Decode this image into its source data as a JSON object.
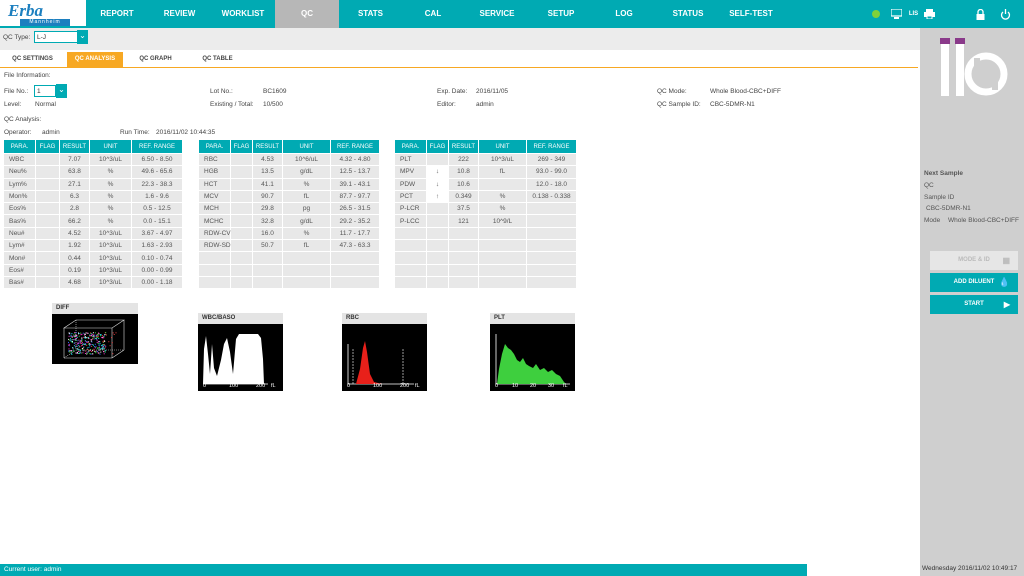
{
  "app": {
    "logo": "Erba",
    "logo_sub": "Mannheim"
  },
  "nav": [
    {
      "label": "REPORT"
    },
    {
      "label": "REVIEW"
    },
    {
      "label": "WORKLIST"
    },
    {
      "label": "QC"
    },
    {
      "label": "STATS"
    },
    {
      "label": "CAL"
    },
    {
      "label": "SERVICE"
    },
    {
      "label": "SETUP"
    },
    {
      "label": "LOG"
    },
    {
      "label": "STATUS"
    },
    {
      "label": "SELF-TEST"
    }
  ],
  "nav_active": "QC",
  "top_icons": [
    "status-dot-icon",
    "network-icon",
    "language-icon",
    "printer-icon",
    "lock-icon",
    "power-icon"
  ],
  "status_dot_color": "#7fd13b",
  "qc_type": {
    "label": "QC Type:",
    "value": "L-J"
  },
  "tabs": [
    {
      "label": "QC SETTINGS"
    },
    {
      "label": "QC ANALYSIS"
    },
    {
      "label": "QC GRAPH"
    },
    {
      "label": "QC TABLE"
    }
  ],
  "tab_active": "QC ANALYSIS",
  "file_info": {
    "heading": "File Information:",
    "file_no_label": "File No.:",
    "file_no_value": "1",
    "level_label": "Level:",
    "level_value": "Normal",
    "lot_label": "Lot No.:",
    "lot_value": "BC1609",
    "existing_label": "Existing / Total:",
    "existing_value": "10/500",
    "exp_label": "Exp. Date:",
    "exp_value": "2016/11/05",
    "editor_label": "Editor:",
    "editor_value": "admin",
    "mode_label": "QC Mode:",
    "mode_value": "Whole Blood-CBC+DIFF",
    "sample_label": "QC Sample ID:",
    "sample_value": "CBC-5DMR-N1"
  },
  "analysis": {
    "heading": "QC Analysis:",
    "operator_label": "Operator:",
    "operator_value": "admin",
    "runtime_label": "Run Time:",
    "runtime_value": "2016/11/02 10:44:35"
  },
  "table_headers": [
    "PARA.",
    "FLAG",
    "RESULT",
    "UNIT",
    "REF. RANGE"
  ],
  "wbc_table": [
    [
      "WBC",
      "",
      "7.07",
      "10^3/uL",
      "6.50 - 8.50"
    ],
    [
      "Neu%",
      "",
      "63.8",
      "%",
      "49.6 - 65.6"
    ],
    [
      "Lym%",
      "",
      "27.1",
      "%",
      "22.3 - 38.3"
    ],
    [
      "Mon%",
      "",
      "6.3",
      "%",
      "1.6 - 9.6"
    ],
    [
      "Eos%",
      "",
      "2.8",
      "%",
      "0.5 - 12.5"
    ],
    [
      "Bas%",
      "",
      "66.2",
      "%",
      "0.0 - 15.1"
    ],
    [
      "Neu#",
      "",
      "4.52",
      "10^3/uL",
      "3.67 - 4.97"
    ],
    [
      "Lym#",
      "",
      "1.92",
      "10^3/uL",
      "1.63 - 2.93"
    ],
    [
      "Mon#",
      "",
      "0.44",
      "10^3/uL",
      "0.10 - 0.74"
    ],
    [
      "Eos#",
      "",
      "0.19",
      "10^3/uL",
      "0.00 - 0.99"
    ],
    [
      "Bas#",
      "",
      "4.68",
      "10^3/uL",
      "0.00 - 1.18"
    ]
  ],
  "rbc_table": [
    [
      "RBC",
      "",
      "4.53",
      "10^6/uL",
      "4.32 - 4.80"
    ],
    [
      "HGB",
      "",
      "13.5",
      "g/dL",
      "12.5 - 13.7"
    ],
    [
      "HCT",
      "",
      "41.1",
      "%",
      "39.1 - 43.1"
    ],
    [
      "MCV",
      "",
      "90.7",
      "fL",
      "87.7 - 97.7"
    ],
    [
      "MCH",
      "",
      "29.8",
      "pg",
      "26.5 - 31.5"
    ],
    [
      "MCHC",
      "",
      "32.8",
      "g/dL",
      "29.2 - 35.2"
    ],
    [
      "RDW-CV",
      "",
      "16.0",
      "%",
      "11.7 - 17.7"
    ],
    [
      "RDW-SD",
      "",
      "50.7",
      "fL",
      "47.3 - 63.3"
    ],
    [
      "",
      "",
      "",
      "",
      ""
    ],
    [
      "",
      "",
      "",
      "",
      ""
    ],
    [
      "",
      "",
      "",
      "",
      ""
    ]
  ],
  "plt_table": [
    [
      "PLT",
      "",
      "222",
      "10^3/uL",
      "269 - 349"
    ],
    [
      "MPV",
      "↓",
      "10.8",
      "fL",
      "93.0 - 99.0"
    ],
    [
      "PDW",
      "↓",
      "10.6",
      "",
      "12.0 - 18.0"
    ],
    [
      "PCT",
      "↑",
      "0.349",
      "%",
      "0.138 - 0.338"
    ],
    [
      "P-LCR",
      "",
      "37.5",
      "%",
      ""
    ],
    [
      "P-LCC",
      "",
      "121",
      "10^9/L",
      ""
    ],
    [
      "",
      "",
      "",
      "",
      ""
    ],
    [
      "",
      "",
      "",
      "",
      ""
    ],
    [
      "",
      "",
      "",
      "",
      ""
    ],
    [
      "",
      "",
      "",
      "",
      ""
    ],
    [
      "",
      "",
      "",
      "",
      ""
    ]
  ],
  "histograms": {
    "diff": {
      "title": "DIFF"
    },
    "wbc": {
      "title": "WBC/BASO",
      "ticks": [
        "0",
        "100",
        "200",
        "fL"
      ]
    },
    "rbc": {
      "title": "RBC",
      "ticks": [
        "0",
        "100",
        "200",
        "fL"
      ],
      "color": "#e8201a"
    },
    "plt": {
      "title": "PLT",
      "ticks": [
        "0",
        "10",
        "20",
        "30",
        "fL"
      ],
      "color": "#3ecf3e"
    }
  },
  "right_panel": {
    "next_sample": "Next Sample",
    "qc": "QC",
    "sample_id_label": "Sample ID",
    "sample_id_value": "CBC-5DMR-N1",
    "mode_label": "Mode",
    "mode_value": "Whole Blood-CBC+DIFF",
    "mode_id_button": "MODE & ID",
    "add_diluent_button": "ADD DILUENT",
    "start_button": "START"
  },
  "status_bar": {
    "user": "Current user: admin",
    "clock": "Wednesday 2016/11/02 10:49:17"
  }
}
